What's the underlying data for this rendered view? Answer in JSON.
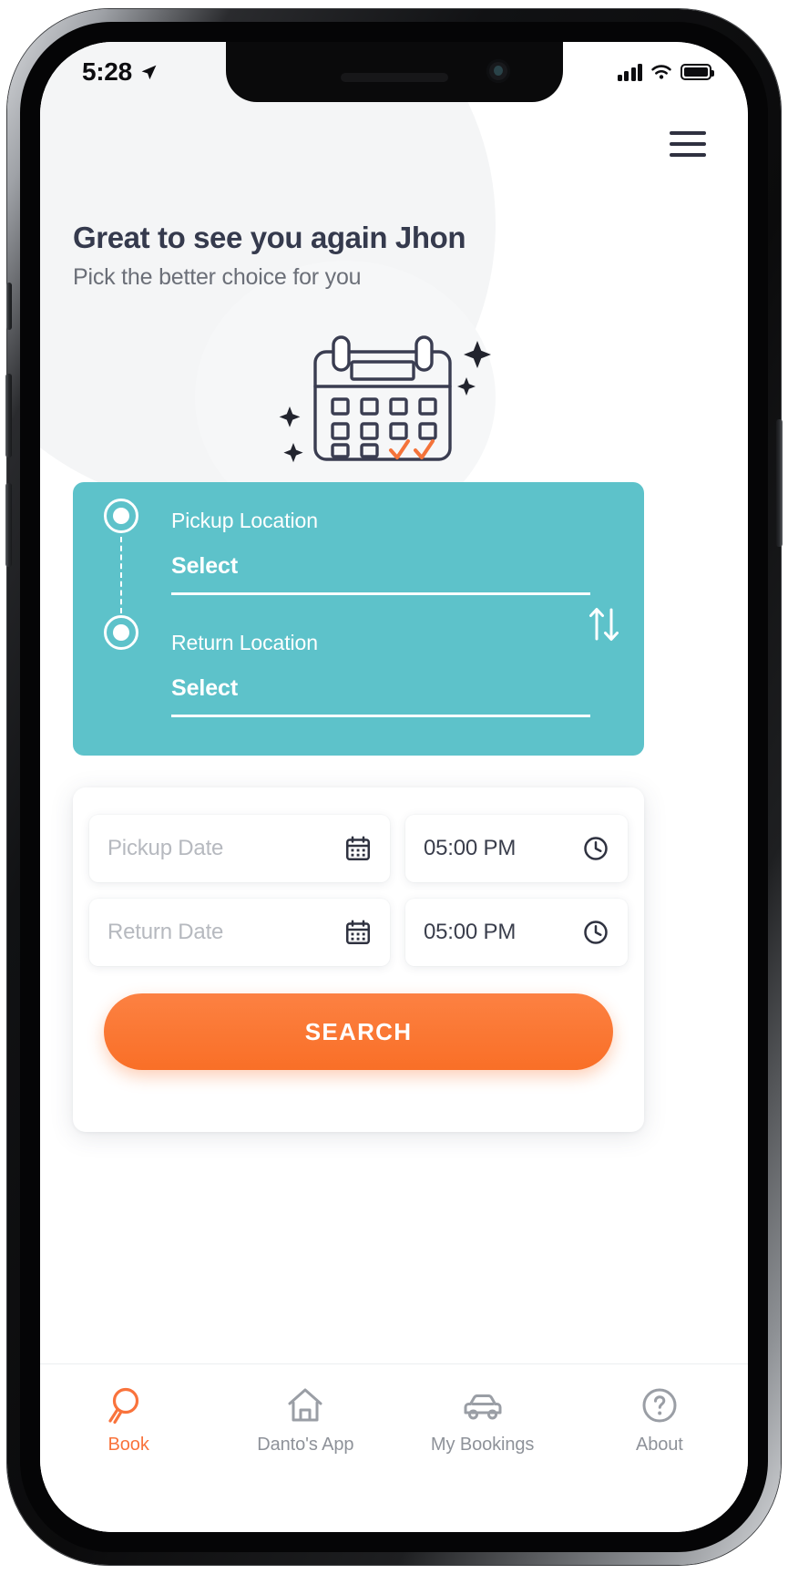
{
  "status_bar": {
    "time": "5:28",
    "location_icon": "location-arrow-icon",
    "signal_icon": "cellular-signal-icon",
    "wifi_icon": "wifi-icon",
    "battery_icon": "battery-full-icon"
  },
  "header": {
    "menu_icon": "hamburger-menu-icon",
    "title": "Great to see you again Jhon",
    "subtitle": "Pick the better choice for you",
    "illustration": "calendar-with-sparkles-illustration"
  },
  "location_card": {
    "background_color": "#5dc2ca",
    "pickup": {
      "label": "Pickup Location",
      "value": "Select",
      "marker_icon": "radio-dot-icon"
    },
    "return": {
      "label": "Return Location",
      "value": "Select",
      "marker_icon": "radio-dot-icon"
    },
    "swap_icon": "swap-vertical-arrows-icon"
  },
  "booking_card": {
    "rows": [
      {
        "date_placeholder": "Pickup Date",
        "date_value": "",
        "date_icon": "calendar-icon",
        "time_value": "05:00 PM",
        "time_icon": "clock-icon"
      },
      {
        "date_placeholder": "Return Date",
        "date_value": "",
        "date_icon": "calendar-icon",
        "time_value": "05:00 PM",
        "time_icon": "clock-icon"
      }
    ],
    "search_label": "SEARCH",
    "search_color": "#f96f27"
  },
  "tabbar": {
    "active_color": "#f9733c",
    "inactive_color": "#8e9299",
    "items": [
      {
        "label": "Book",
        "icon": "search-magnifier-icon",
        "active": true
      },
      {
        "label": "Danto's App",
        "icon": "home-house-icon",
        "active": false
      },
      {
        "label": "My Bookings",
        "icon": "car-icon",
        "active": false
      },
      {
        "label": "About",
        "icon": "question-mark-circle-icon",
        "active": false
      }
    ]
  }
}
